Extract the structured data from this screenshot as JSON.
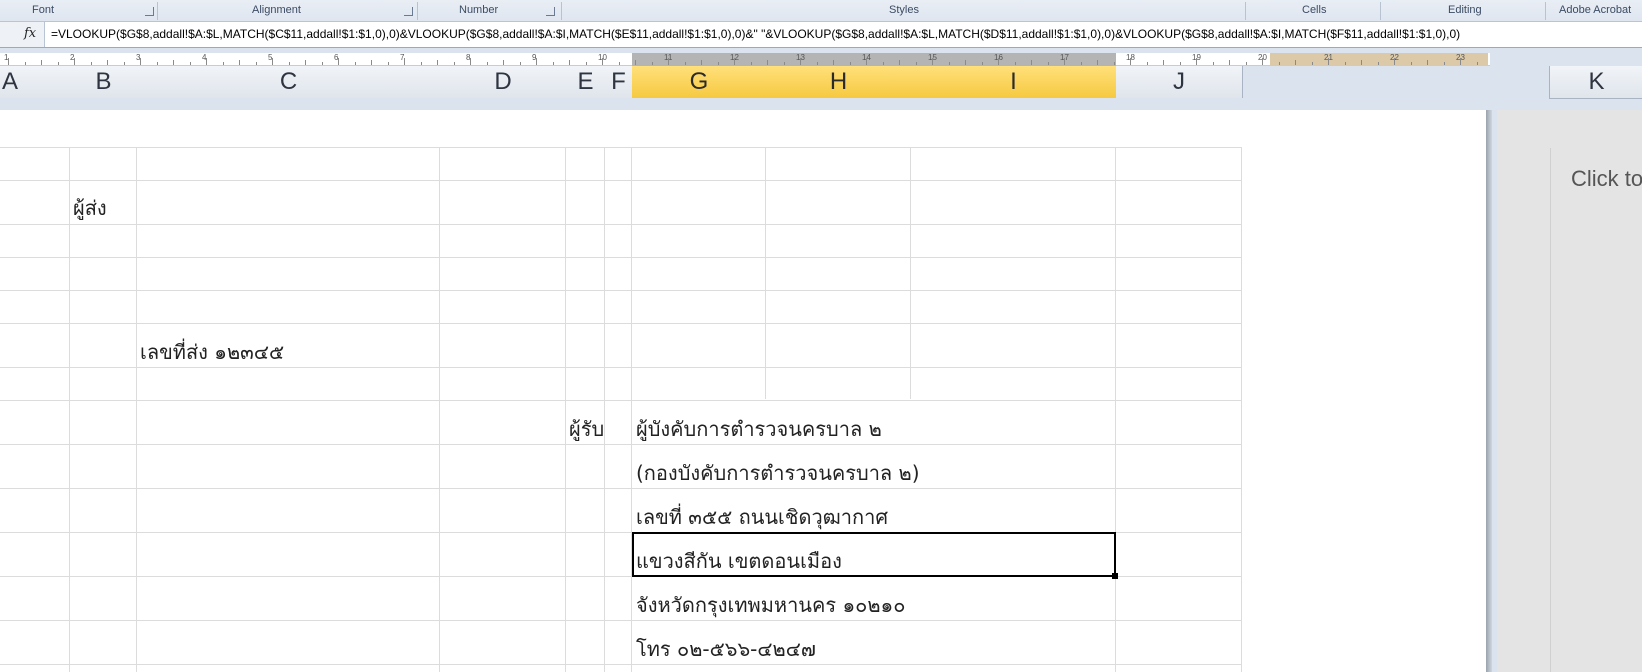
{
  "ribbon": {
    "groups": [
      "Font",
      "Alignment",
      "Number",
      "Styles",
      "Cells",
      "Editing",
      "Adobe Acrobat"
    ]
  },
  "formula_bar": {
    "fx": "fx",
    "formula": "=VLOOKUP($G$8,addall!$A:$L,MATCH($C$11,addall!$1:$1,0),0)&VLOOKUP($G$8,addall!$A:$I,MATCH($E$11,addall!$1:$1,0),0)&\" \"&VLOOKUP($G$8,addall!$A:$L,MATCH($D$11,addall!$1:$1,0),0)&VLOOKUP($G$8,addall!$A:$I,MATCH($F$11,addall!$1:$1,0),0)"
  },
  "ruler": {
    "numbers": [
      "1",
      "2",
      "3",
      "4",
      "5",
      "6",
      "7",
      "8",
      "9",
      "10",
      "11",
      "12",
      "13",
      "14",
      "15",
      "16",
      "17",
      "18",
      "19",
      "20",
      "21",
      "22",
      "23"
    ]
  },
  "columns": [
    "A",
    "B",
    "C",
    "D",
    "E",
    "F",
    "G",
    "H",
    "I",
    "J",
    "K"
  ],
  "selected_columns": [
    "G",
    "H",
    "I"
  ],
  "cells": {
    "sender_label": "ผู้ส่ง",
    "dispatch_no": "เลขที่ส่ง ๑๒๓๔๕",
    "recipient_label": "ผู้รับ",
    "recipient_line1": "ผู้บังคับการตำรวจนครบาล ๒",
    "recipient_line2": "(กองบังคับการตำรวจนครบาล ๒)",
    "recipient_line3": "เลขที่ ๓๕๕ ถนนเชิดวุฒากาศ",
    "recipient_line4": "แขวงสีกัน เขตดอนเมือง",
    "recipient_line5": "จังหวัดกรุงเทพมหานคร  ๑๐๒๑๐",
    "recipient_line6": "โทร ๐๒-๕๖๖-๔๒๔๗"
  },
  "side_panel": {
    "placeholder": "Click to"
  },
  "colors": {
    "selected_header": "#f6c940",
    "ribbon_bg": "#dfe6f0",
    "grid": "#dcdcdc"
  }
}
